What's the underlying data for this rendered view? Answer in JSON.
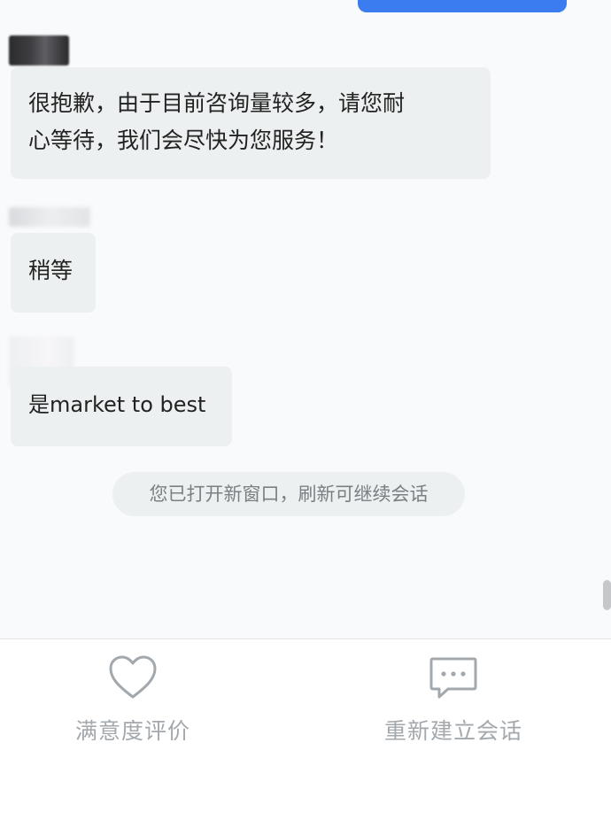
{
  "messages": [
    {
      "text": "很抱歉，由于目前咨询量较多，请您耐\n心等待，我们会尽快为您服务！"
    },
    {
      "text": "稍等"
    },
    {
      "text": "是market to best"
    }
  ],
  "system_notice": "您已打开新窗口，刷新可继续会话",
  "actions": {
    "rate_label": "满意度评价",
    "rate_icon": "heart-icon",
    "restart_label": "重新建立会话",
    "restart_icon": "chat-bubble-icon"
  },
  "colors": {
    "sent_bubble": "#3b7cf0",
    "received_bubble": "#edf0f0",
    "action_gray": "#a3a8ad"
  }
}
